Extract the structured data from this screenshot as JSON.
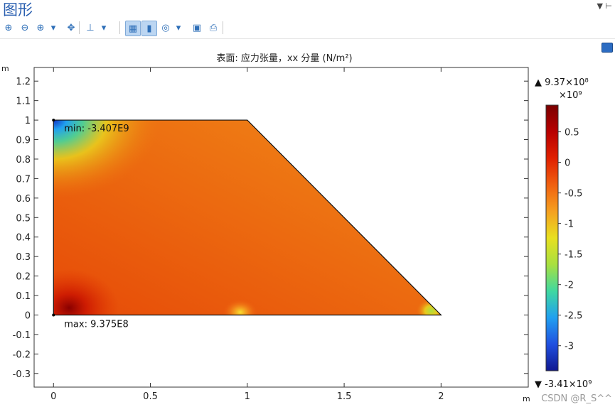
{
  "window": {
    "title": "图形",
    "controls": "▼ ⊢"
  },
  "toolbar": {
    "buttons": [
      {
        "name": "zoom-in-icon",
        "glyph": "⊕"
      },
      {
        "name": "zoom-out-icon",
        "glyph": "⊖"
      },
      {
        "name": "zoom-box-icon",
        "glyph": "⊕"
      },
      {
        "name": "dropdown-icon",
        "glyph": "▾"
      },
      {
        "name": "zoom-extents-icon",
        "glyph": "✥"
      },
      {
        "name": "axis-orientation-icon",
        "glyph": "⊥"
      },
      {
        "name": "dropdown-icon",
        "glyph": "▾"
      },
      {
        "name": "grid-toggle-icon",
        "glyph": "▦"
      },
      {
        "name": "color-legend-icon",
        "glyph": "▮"
      },
      {
        "name": "scene-light-icon",
        "glyph": "◎"
      },
      {
        "name": "dropdown-icon",
        "glyph": "▾"
      },
      {
        "name": "camera-icon",
        "glyph": "▣"
      },
      {
        "name": "print-icon",
        "glyph": "⎙"
      }
    ]
  },
  "plot": {
    "title": "表面: 应力张量，xx 分量 (N/m²)",
    "y_unit": "m",
    "x_unit": "m",
    "min_label": "min: -3.407E9",
    "max_label": "max: 9.375E8"
  },
  "chart_data": {
    "type": "heatmap",
    "title": "表面: 应力张量，xx 分量 (N/m²)",
    "xlim": [
      -0.1,
      2.45
    ],
    "ylim": [
      -0.37,
      1.27
    ],
    "x_ticks": [
      "0",
      "0.5",
      "1",
      "1.5",
      "2"
    ],
    "y_ticks": [
      "1.2",
      "1.1",
      "1",
      "0.9",
      "0.8",
      "0.7",
      "0.6",
      "0.5",
      "0.4",
      "0.3",
      "0.2",
      "0.1",
      "0",
      "-0.1",
      "-0.2",
      "-0.3"
    ],
    "domain_polygon": [
      [
        0,
        0
      ],
      [
        0,
        1
      ],
      [
        1,
        1
      ],
      [
        2,
        0
      ]
    ],
    "min": {
      "value": -3407000000.0,
      "label": "min: -3.407E9",
      "at": [
        0,
        1
      ]
    },
    "max": {
      "value": 937500000.0,
      "label": "max: 9.375E8",
      "at": [
        0,
        0
      ]
    },
    "colorbar": {
      "top_label": "▲ 9.37×10⁸",
      "bottom_label": "▼ -3.41×10⁹",
      "multiplier": "×10⁹",
      "range": [
        -3.41,
        0.937
      ],
      "ticks": [
        "0.5",
        "0",
        "-0.5",
        "-1",
        "-1.5",
        "-2",
        "-2.5",
        "-3"
      ],
      "colors": [
        "#7a0000",
        "#b80000",
        "#e02000",
        "#f06010",
        "#f5a020",
        "#e8e020",
        "#a8e040",
        "#40d8a0",
        "#20a0f0",
        "#2050e0",
        "#101890"
      ]
    }
  },
  "watermark": "CSDN @R_S^^"
}
